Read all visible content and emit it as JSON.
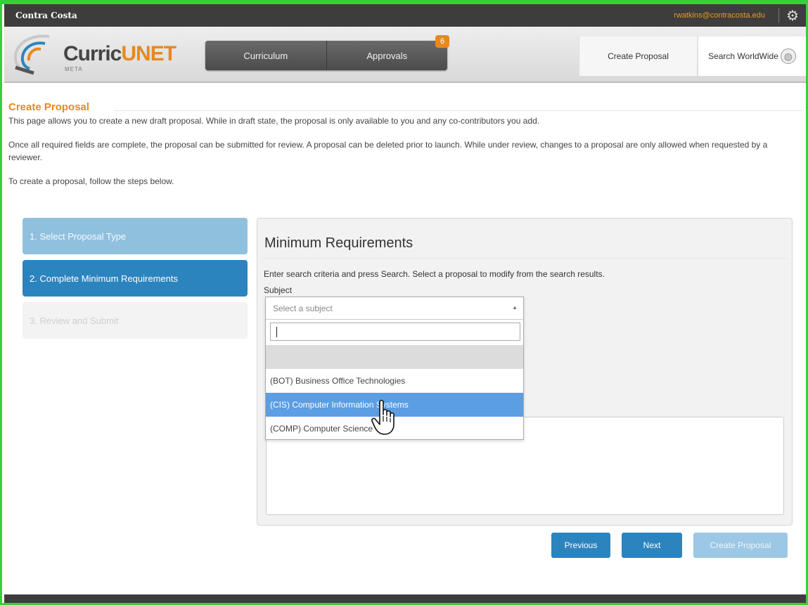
{
  "topbar": {
    "org": "Contra Costa",
    "email": "rwatkins@contracosta.edu",
    "settings_icon": "gear-icon"
  },
  "header": {
    "logo": {
      "part1": "Curric",
      "part2": "UNET",
      "sub": "META"
    },
    "nav": {
      "curriculum": "Curriculum",
      "approvals": "Approvals",
      "approvals_badge": "6"
    },
    "tabs": {
      "create_proposal": "Create Proposal",
      "search_worldwide": "Search WorldWide"
    },
    "colors": {
      "accent": "#e8891b",
      "bar": "#3d3d3d"
    }
  },
  "page": {
    "title": "Create Proposal",
    "intro1": "This page allows you to create a new draft proposal. While in draft state, the proposal is only available to you and any co-contributors you add.",
    "intro2": "Once all required fields are complete, the proposal can be submitted for review. A proposal can be deleted prior to launch. While under review, changes to a proposal are only allowed when requested by a reviewer.",
    "intro3": "To create a proposal, follow the steps below."
  },
  "steps": [
    {
      "label": "1. Select Proposal Type"
    },
    {
      "label": "2. Complete Minimum Requirements"
    },
    {
      "label": "3. Review and Submit"
    }
  ],
  "panel": {
    "title": "Minimum Requirements",
    "description": "Enter search criteria and press Search. Select a proposal to modify from the search results.",
    "subject_label": "Subject",
    "subject_placeholder": "Select a subject",
    "search_value": "",
    "options": [
      "",
      "(BOT) Business Office Technologies",
      "(CIS) Computer Information Systems",
      "(COMP) Computer Science"
    ],
    "highlighted_option": "(CIS) Computer Information Systems"
  },
  "buttons": {
    "previous": "Previous",
    "next": "Next",
    "create": "Create Proposal"
  }
}
